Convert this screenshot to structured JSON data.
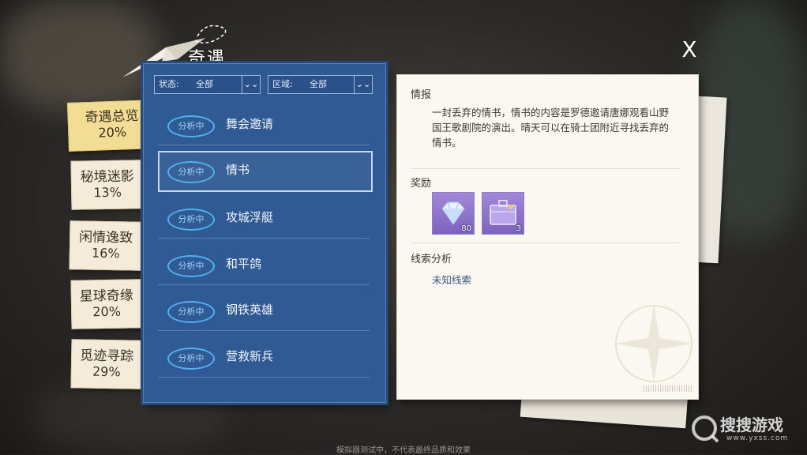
{
  "header": {
    "title": "奇遇",
    "close_label": "X"
  },
  "tabs": [
    {
      "name": "奇遇总览",
      "pct": "20%",
      "active": true
    },
    {
      "name": "秘境迷影",
      "pct": "13%"
    },
    {
      "name": "闲情逸致",
      "pct": "16%"
    },
    {
      "name": "星球奇缘",
      "pct": "20%"
    },
    {
      "name": "觅迹寻踪",
      "pct": "29%"
    }
  ],
  "filters": {
    "status": {
      "label": "状态:",
      "value": "全部"
    },
    "region": {
      "label": "区域:",
      "value": "全部"
    }
  },
  "list": [
    {
      "badge": "分析中",
      "title": "舞会邀请"
    },
    {
      "badge": "分析中",
      "title": "情书",
      "selected": true
    },
    {
      "badge": "分析中",
      "title": "攻城浮艇"
    },
    {
      "badge": "分析中",
      "title": "和平鸽"
    },
    {
      "badge": "分析中",
      "title": "钢铁英雄"
    },
    {
      "badge": "分析中",
      "title": "营救新兵"
    }
  ],
  "detail": {
    "info_heading": "情报",
    "info_text": "一封丢弃的情书，情书的内容是罗德邀请唐娜观看山野国王歌剧院的演出。晴天可以在骑士团附近寻找丢弃的情书。",
    "reward_heading": "奖励",
    "rewards": [
      {
        "icon": "diamond-icon",
        "qty": "80"
      },
      {
        "icon": "chest-icon",
        "qty": "3"
      }
    ],
    "clue_heading": "线索分析",
    "clue_text": "未知线索"
  },
  "footer": "模拟器测试中，不代表最终品质和效果",
  "watermark": {
    "text": "搜搜游戏",
    "url": "www.yxss.com"
  },
  "colors": {
    "panel_blue": "#2f5a94",
    "badge_cyan": "#4fb1ee",
    "tab_active": "#f3dc93",
    "paper": "#fbf8f2"
  }
}
